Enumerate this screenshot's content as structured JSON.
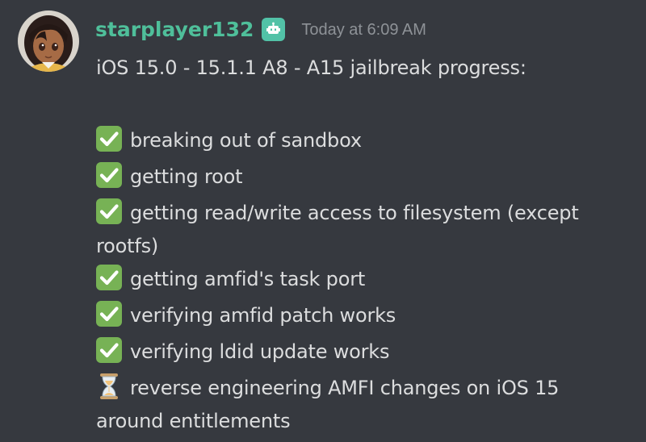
{
  "message": {
    "author": {
      "username": "starplayer132",
      "avatar_icon": "anime-girl-avatar",
      "badge_icon": "bot-robot-icon"
    },
    "timestamp": "Today at 6:09 AM",
    "title": "iOS 15.0 - 15.1.1 A8 - A15 jailbreak progress:",
    "items": [
      {
        "status": "done",
        "icon": "white-check-mark-icon",
        "text": "breaking out of sandbox"
      },
      {
        "status": "done",
        "icon": "white-check-mark-icon",
        "text": "getting root"
      },
      {
        "status": "done",
        "icon": "white-check-mark-icon",
        "text": "getting read/write access to filesystem (except",
        "continuation": "rootfs)"
      },
      {
        "status": "done",
        "icon": "white-check-mark-icon",
        "text": "getting amfid's task port"
      },
      {
        "status": "done",
        "icon": "white-check-mark-icon",
        "text": "verifying amfid patch works"
      },
      {
        "status": "done",
        "icon": "white-check-mark-icon",
        "text": "verifying ldid update works"
      },
      {
        "status": "in-progress",
        "icon": "hourglass-icon",
        "text": "reverse engineering AMFI changes on iOS 15",
        "continuation": "around entitlements"
      }
    ]
  },
  "colors": {
    "background": "#36393f",
    "username": "#4fbf9a",
    "timestamp": "#8e9297",
    "text": "#dcddde",
    "check": "#77b255",
    "badge": "#52c2a7"
  }
}
